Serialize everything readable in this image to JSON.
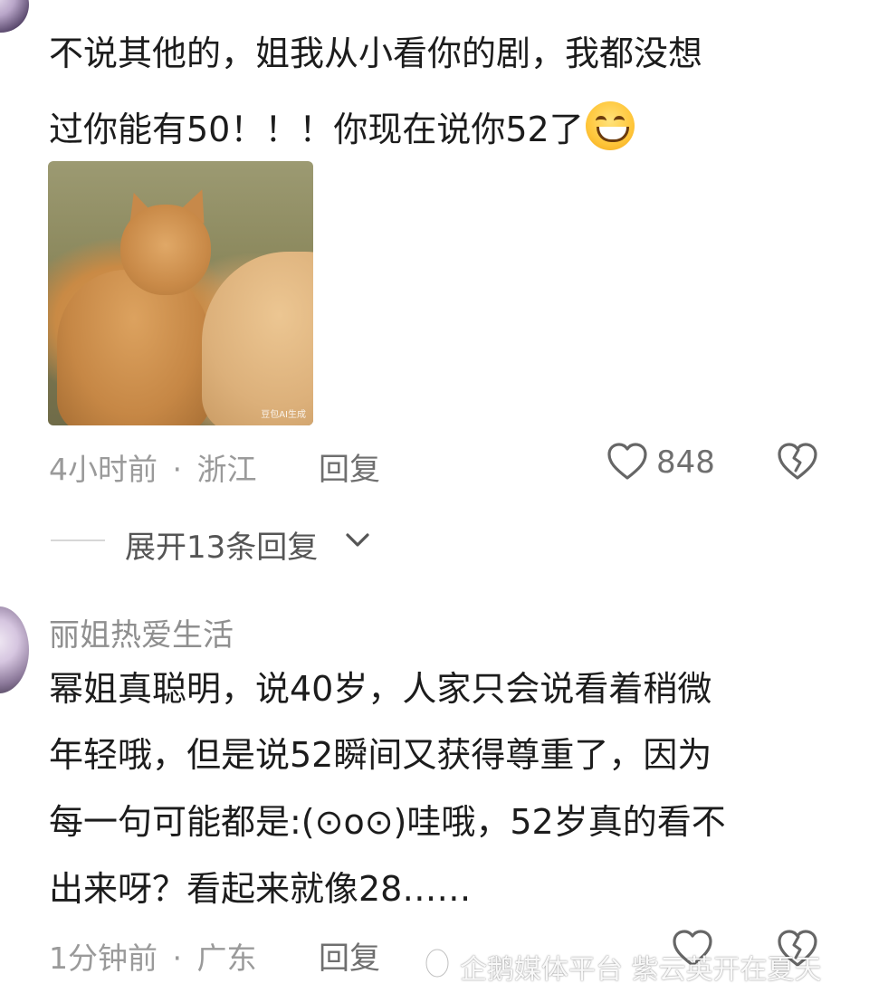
{
  "comments": [
    {
      "username": "",
      "body_lines": [
        "不说其他的，姐我从小看你的剧，我都没想",
        "过你能有50！！！你现在说你52了"
      ],
      "emoji": "grinning-squint-emoji",
      "image_watermark": "豆包AI生成",
      "time": "4小时前",
      "location": "浙江",
      "meta_separator": "·",
      "reply_label": "回复",
      "like_count": "848"
    },
    {
      "username": "丽姐热爱生活",
      "body_lines": [
        "幂姐真聪明，说40岁，人家只会说看着稍微",
        "年轻哦，但是说52瞬间又获得尊重了，因为",
        "每一句可能都是:(⊙o⊙)哇哦，52岁真的看不",
        "出来呀？看起来就像28……"
      ],
      "time": "1分钟前",
      "location": "广东",
      "meta_separator": "·",
      "reply_label": "回复"
    }
  ],
  "expand_replies": {
    "label": "展开13条回复",
    "icon": "chevron-down-icon"
  },
  "watermark": {
    "text": "企鹅媒体平台 紫云英开在夏天",
    "icon": "penguin-icon"
  },
  "colors": {
    "text_primary": "#1c1c1c",
    "text_secondary": "#9a9a9a",
    "background": "#ffffff"
  }
}
